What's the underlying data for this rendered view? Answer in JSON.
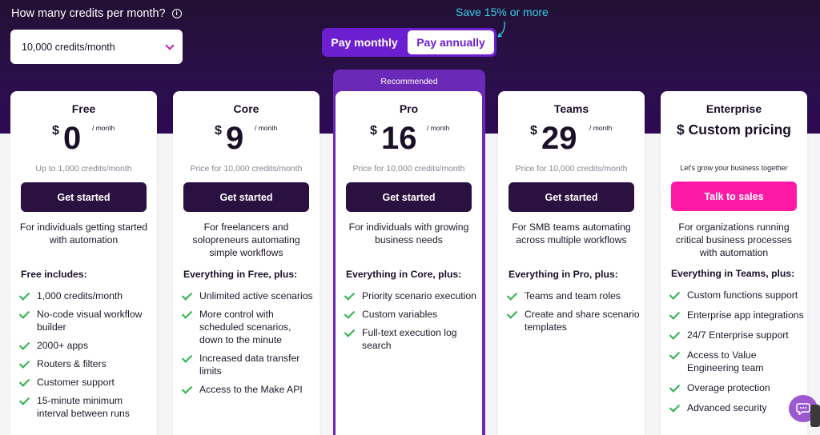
{
  "header": {
    "question": "How many credits per month?",
    "info_icon": "info-icon",
    "credits_selected": "10,000 credits/month",
    "save_note": "Save 15% or more",
    "billing_toggle": {
      "monthly": "Pay monthly",
      "annually": "Pay annually",
      "active": "annually"
    }
  },
  "recommended_label": "Recommended",
  "plans": [
    {
      "name": "Free",
      "currency": "$",
      "amount": "0",
      "period": "/ month",
      "subtitle": "Up to 1,000 credits/month",
      "cta": "Get started",
      "description": "For individuals getting started with automation",
      "includes_title": "Free includes:",
      "features": [
        "1,000 credits/month",
        "No-code visual workflow builder",
        "2000+ apps",
        "Routers & filters",
        "Customer support",
        "15-minute minimum interval between runs"
      ]
    },
    {
      "name": "Core",
      "currency": "$",
      "amount": "9",
      "period": "/ month",
      "subtitle": "Price for 10,000 credits/month",
      "cta": "Get started",
      "description": "For freelancers and solopreneurs automating simple workflows",
      "includes_title": "Everything in Free, plus:",
      "features": [
        "Unlimited active scenarios",
        "More control with scheduled scenarios, down to the minute",
        "Increased data transfer limits",
        "Access to the Make API"
      ]
    },
    {
      "name": "Pro",
      "currency": "$",
      "amount": "16",
      "period": "/ month",
      "subtitle": "Price for 10,000 credits/month",
      "cta": "Get started",
      "description": "For individuals with growing business needs",
      "includes_title": "Everything in Core, plus:",
      "features": [
        "Priority scenario execution",
        "Custom variables",
        "Full-text execution log search"
      ]
    },
    {
      "name": "Teams",
      "currency": "$",
      "amount": "29",
      "period": "/ month",
      "subtitle": "Price for 10,000 credits/month",
      "cta": "Get started",
      "description": "For SMB teams automating across multiple workflows",
      "includes_title": "Everything in Pro, plus:",
      "features": [
        "Teams and team roles",
        "Create and share scenario templates"
      ]
    },
    {
      "name": "Enterprise",
      "custom_price": "$ Custom pricing",
      "subtitle": "Let's grow your business together",
      "cta": "Talk to sales",
      "description": "For organizations running critical business processes with automation",
      "includes_title": "Everything in Teams, plus:",
      "features": [
        "Custom functions support",
        "Enterprise app integrations",
        "24/7 Enterprise support",
        "Access to Value Engineering team",
        "Overage protection",
        "Advanced security"
      ]
    }
  ],
  "colors": {
    "brand_purple": "#6c1fd1",
    "dark_button": "#2b1140",
    "sales_pink": "#ff1aa6",
    "check_green": "#2db34a",
    "save_cyan": "#33d1e6"
  },
  "chat_icon": "chat-bubble-icon"
}
